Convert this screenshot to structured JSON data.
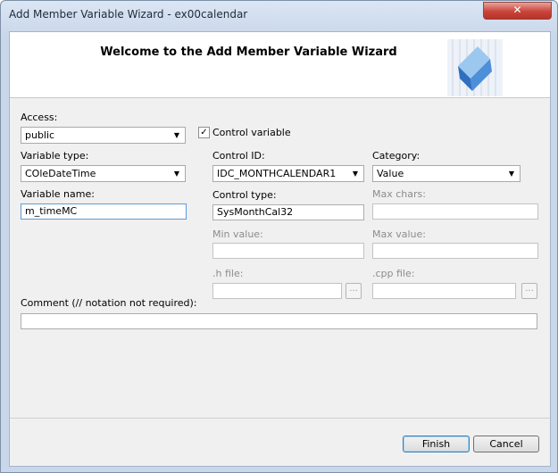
{
  "window": {
    "title": "Add Member Variable Wizard - ex00calendar",
    "close_symbol": "✕"
  },
  "banner": {
    "title": "Welcome to the Add Member Variable Wizard",
    "logo_icon": "blue-cube-icon"
  },
  "form": {
    "access_label": "Access:",
    "access_value": "public",
    "control_variable_label": "Control variable",
    "control_variable_checked": true,
    "variable_type_label": "Variable type:",
    "variable_type_value": "COleDateTime",
    "variable_name_label": "Variable name:",
    "variable_name_value": "m_timeMC",
    "control_id_label": "Control ID:",
    "control_id_value": "IDC_MONTHCALENDAR1",
    "category_label": "Category:",
    "category_value": "Value",
    "control_type_label": "Control type:",
    "control_type_value": "SysMonthCal32",
    "max_chars_label": "Max chars:",
    "max_chars_value": "",
    "min_value_label": "Min value:",
    "min_value_value": "",
    "max_value_label": "Max value:",
    "max_value_value": "",
    "h_file_label": ".h file:",
    "h_file_value": "",
    "cpp_file_label": ".cpp file:",
    "cpp_file_value": "",
    "browse_label": "...",
    "comment_label": "Comment (// notation not required):",
    "comment_value": ""
  },
  "buttons": {
    "finish_label": "Finish",
    "cancel_label": "Cancel"
  }
}
